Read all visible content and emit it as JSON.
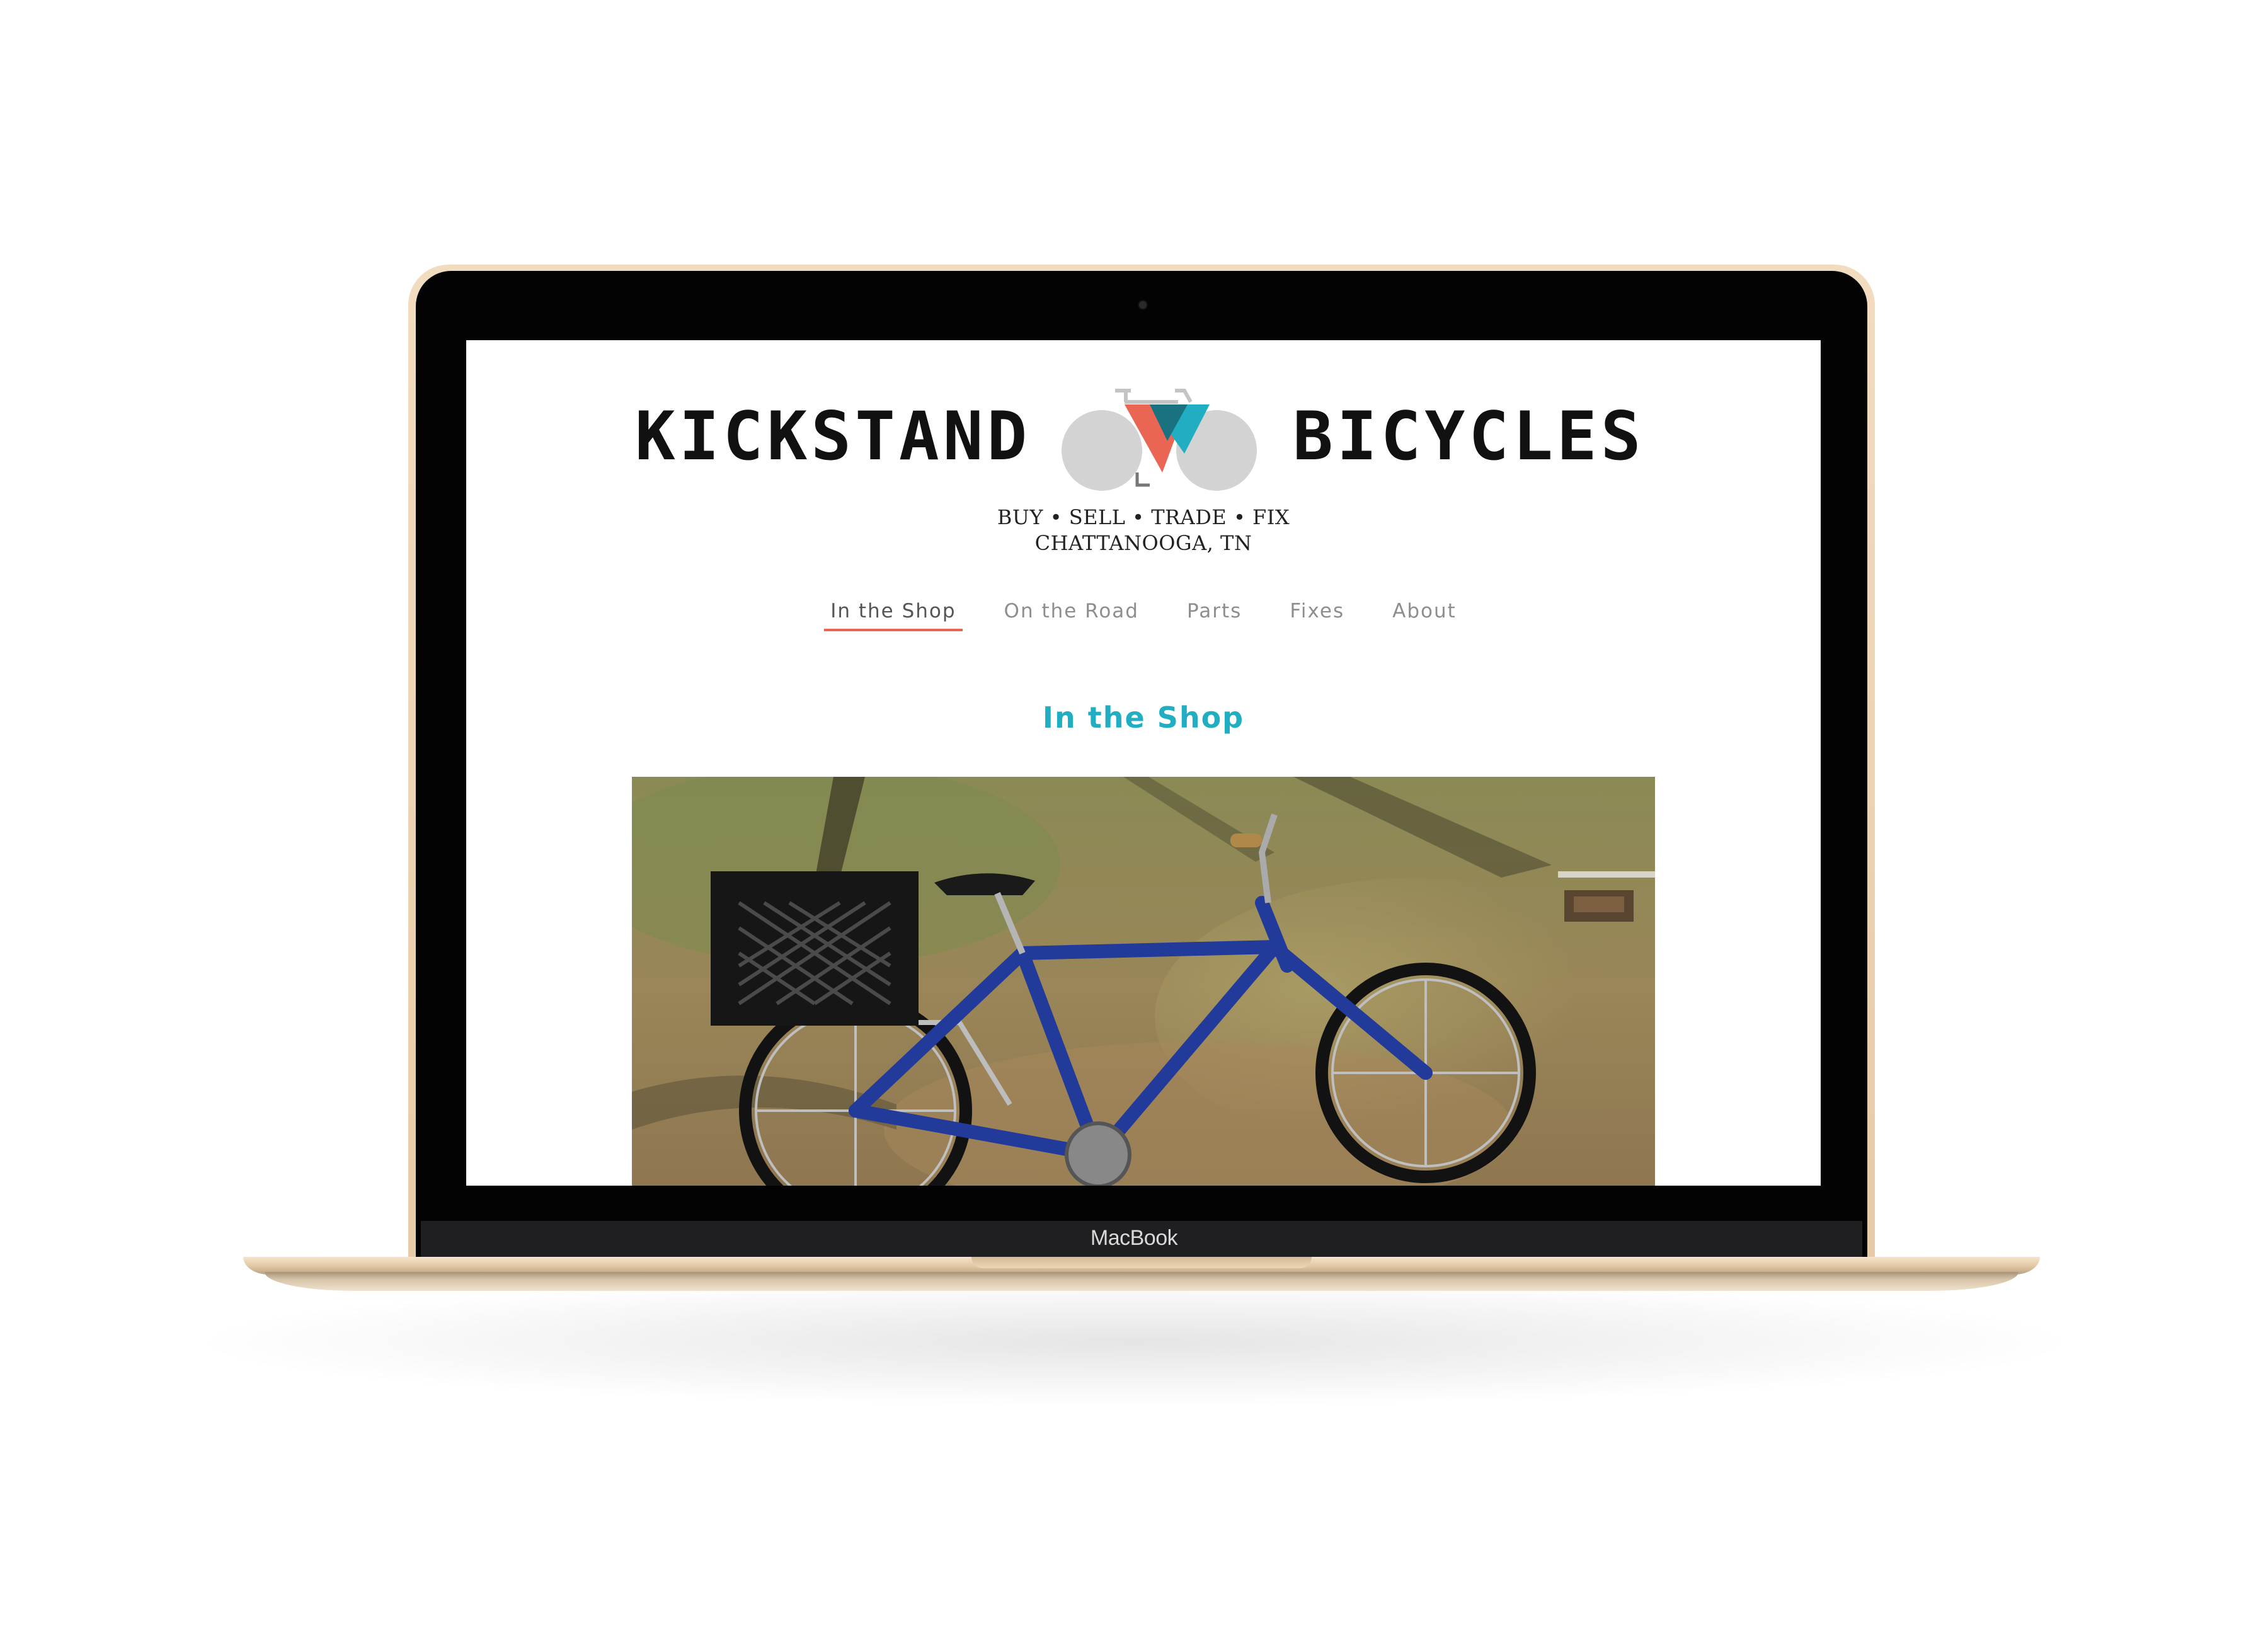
{
  "device": {
    "label": "MacBook",
    "frame_color": "#e8cfae"
  },
  "site": {
    "logo_left": "KICKSTAND",
    "logo_right": "BICYCLES",
    "tagline": "BUY • SELL • TRADE • FIX",
    "location": "CHATTANOOGA, TN",
    "logo_colors": {
      "coral": "#ea6553",
      "teal": "#21aec2",
      "wheel": "#d3d3d3"
    }
  },
  "nav": {
    "items": [
      {
        "label": "In the Shop",
        "active": true
      },
      {
        "label": "On the Road",
        "active": false
      },
      {
        "label": "Parts",
        "active": false
      },
      {
        "label": "Fixes",
        "active": false
      },
      {
        "label": "About",
        "active": false
      }
    ],
    "active_underline_color": "#ea6553"
  },
  "main": {
    "heading": "In the Shop",
    "heading_color": "#21aec2",
    "photo": {
      "subject": "blue bicycle with black crate basket on grass"
    }
  }
}
